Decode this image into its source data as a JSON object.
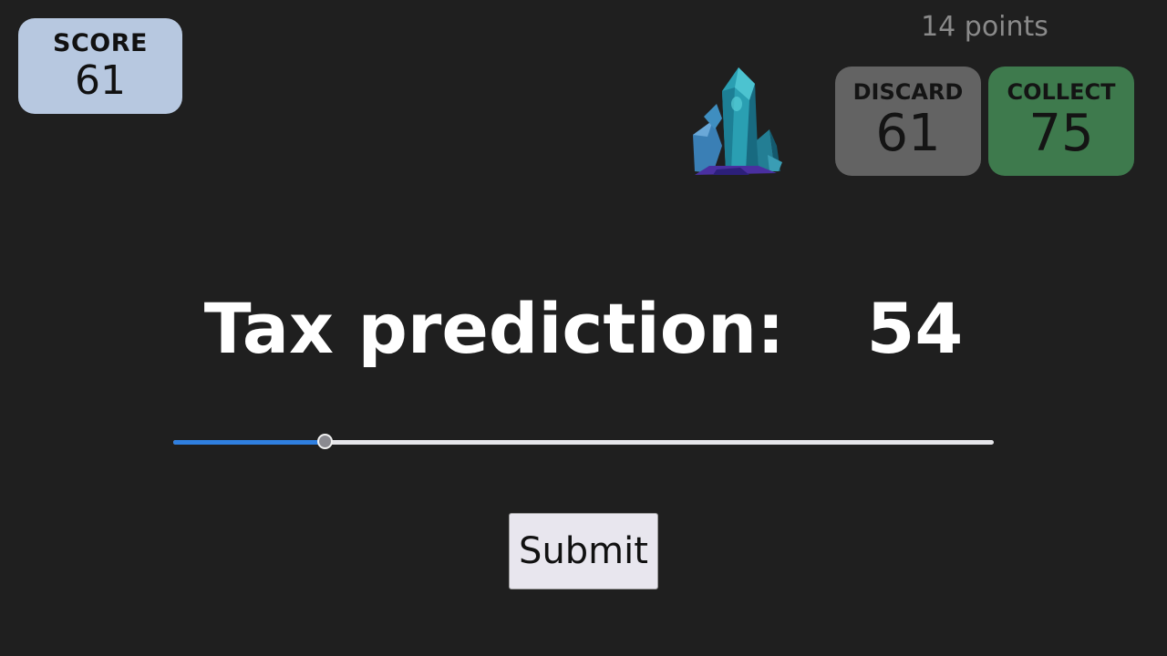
{
  "score": {
    "label": "SCORE",
    "value": "61"
  },
  "points_text": "14 points",
  "gem_icon": "crystal-icon",
  "cards": {
    "discard": {
      "label": "DISCARD",
      "value": "61",
      "color": "#636363"
    },
    "collect": {
      "label": "COLLECT",
      "value": "75",
      "color": "#3e7a4d"
    }
  },
  "prediction": {
    "label": "Tax prediction:",
    "value": "54"
  },
  "slider": {
    "value_fraction": 0.185,
    "fill_color": "#2f7fe0"
  },
  "submit_label": "Submit",
  "colors": {
    "background": "#1f1f1f",
    "score_box": "#b7c8e0"
  }
}
